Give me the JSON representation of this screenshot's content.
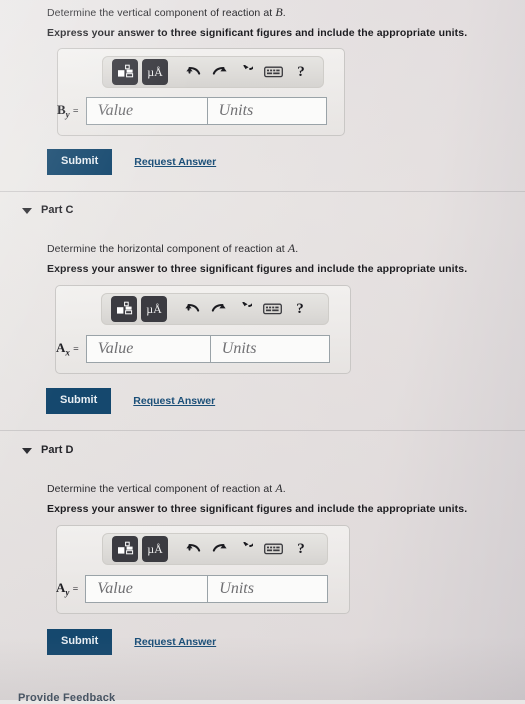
{
  "theme": {
    "submit_color": "#15486e",
    "link_color": "#1b4f78",
    "page_bg": "#eceae8",
    "toolbar_btn_color": "#3b3b41",
    "input_border": "#9aa3a8"
  },
  "toolbar": {
    "buttons": [
      {
        "name": "math-template-icon",
        "label": ""
      },
      {
        "name": "units-micro-angstrom-icon",
        "label": "µÅ"
      }
    ],
    "icons": [
      {
        "name": "undo-icon",
        "label": "undo"
      },
      {
        "name": "redo-icon",
        "label": "redo"
      },
      {
        "name": "reset-icon",
        "label": "reset"
      },
      {
        "name": "keyboard-icon",
        "label": "keyboard"
      },
      {
        "name": "help-icon",
        "label": "?"
      }
    ],
    "help_label": "?"
  },
  "common": {
    "instruction": "Express your answer to three significant figures and include the appropriate units.",
    "value_placeholder": "Value",
    "units_placeholder": "Units",
    "submit_label": "Submit",
    "request_answer_label": "Request Answer"
  },
  "parts": [
    {
      "id": "part-b",
      "title": "",
      "has_header": false,
      "question_prefix": "Determine the vertical component of reaction at",
      "question_var": "B",
      "question_suffix": ".",
      "instruction": "Express your answer to three significant figures and include the appropriate units.",
      "field_label_base": "B",
      "field_label_sub": "y",
      "field_label_eq": "=",
      "value_placeholder": "Value",
      "units_placeholder": "Units",
      "submit_label": "Submit",
      "request_answer_label": "Request Answer"
    },
    {
      "id": "part-c",
      "title": "Part C",
      "has_header": true,
      "question_prefix": "Determine the horizontal component of reaction at",
      "question_var": "A",
      "question_suffix": ".",
      "instruction": "Express your answer to three significant figures and include the appropriate units.",
      "field_label_base": "A",
      "field_label_sub": "x",
      "field_label_eq": "=",
      "value_placeholder": "Value",
      "units_placeholder": "Units",
      "submit_label": "Submit",
      "request_answer_label": "Request Answer"
    },
    {
      "id": "part-d",
      "title": "Part D",
      "has_header": true,
      "question_prefix": "Determine the vertical component of reaction at",
      "question_var": "A",
      "question_suffix": ".",
      "instruction": "Express your answer to three significant figures and include the appropriate units.",
      "field_label_base": "A",
      "field_label_sub": "y",
      "field_label_eq": "=",
      "value_placeholder": "Value",
      "units_placeholder": "Units",
      "submit_label": "Submit",
      "request_answer_label": "Request Answer"
    }
  ],
  "footer": {
    "provide_feedback_label": "Provide Feedback"
  }
}
